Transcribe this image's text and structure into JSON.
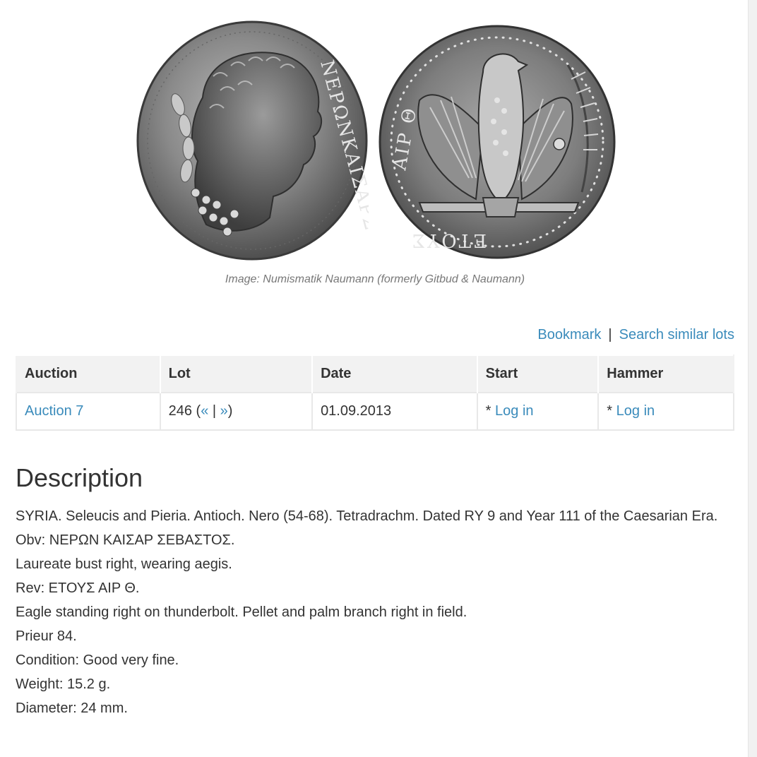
{
  "image": {
    "caption": "Image: Numismatik Naumann (formerly Gitbud & Naumann)",
    "obverse_legend": "ΝΕΡΩΝΚΑΙΣΑΡΣ",
    "reverse_legend_left": "ΑΙΡ Θ",
    "reverse_legend_bottom": "ΕΤΟΥΣ"
  },
  "actions": {
    "bookmark": "Bookmark",
    "separator": "|",
    "search_similar": "Search similar lots"
  },
  "table": {
    "headers": [
      "Auction",
      "Lot",
      "Date",
      "Start",
      "Hammer"
    ],
    "row": {
      "auction": "Auction 7",
      "lot_number": "246 (",
      "lot_prev": "«",
      "lot_sep": " | ",
      "lot_next": "»",
      "lot_close": ")",
      "date": "01.09.2013",
      "start_prefix": "* ",
      "start_link": "Log in",
      "hammer_prefix": "* ",
      "hammer_link": "Log in"
    }
  },
  "description": {
    "heading": "Description",
    "lines": [
      "SYRIA. Seleucis and Pieria. Antioch. Nero (54-68). Tetradrachm. Dated RY 9 and Year 111 of the Caesarian Era.",
      "Obv: ΝΕΡΩΝ ΚΑΙΣΑΡ ΣΕΒΑΣΤΟΣ.",
      "Laureate bust right, wearing aegis.",
      "Rev: ΕΤΟΥΣ ΑΙΡ Θ.",
      "Eagle standing right on thunderbolt. Pellet and palm branch right in field.",
      "Prieur 84.",
      "Condition: Good very fine.",
      "Weight: 15.2 g.",
      "Diameter: 24 mm."
    ]
  },
  "colors": {
    "link": "#3a8bbb",
    "header_bg": "#f2f2f2",
    "text": "#333333"
  }
}
